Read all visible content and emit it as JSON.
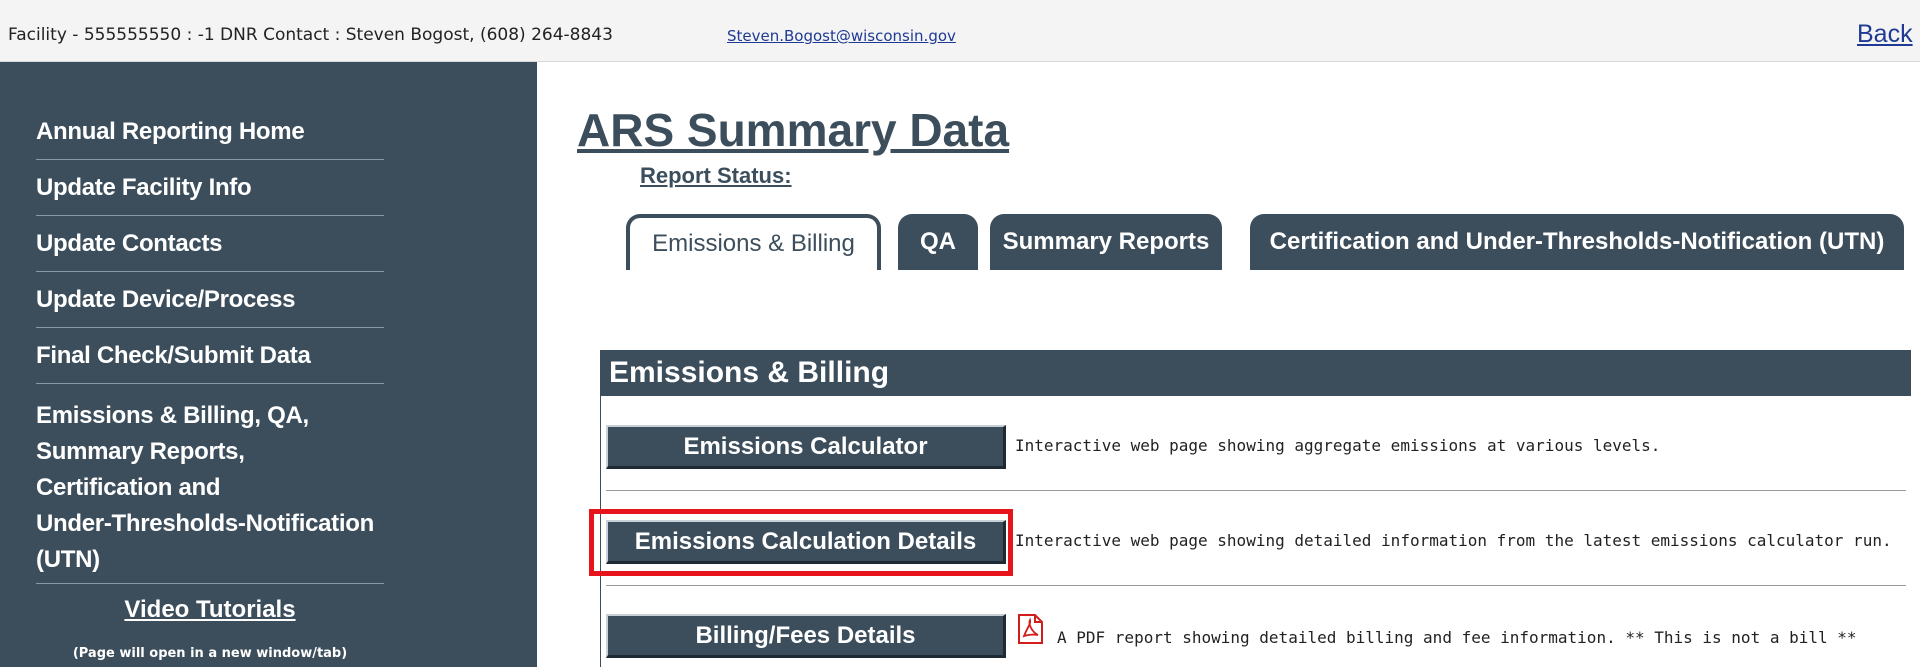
{
  "topbar": {
    "facility_text": "Facility - 555555550 : -1   DNR Contact : Steven Bogost, (608) 264-8843",
    "contact_email": "Steven.Bogost@wisconsin.gov",
    "back_label": "Back"
  },
  "sidebar": {
    "items": [
      {
        "label": "Annual Reporting Home"
      },
      {
        "label": "Update Facility Info"
      },
      {
        "label": "Update Contacts"
      },
      {
        "label": "Update Device/Process"
      },
      {
        "label": "Final Check/Submit Data"
      }
    ],
    "multi_item": {
      "lines": [
        "Emissions & Billing, QA,",
        "Summary Reports,",
        "Certification and",
        "Under-Thresholds-Notification",
        "(UTN)"
      ]
    },
    "video_title": "Video Tutorials",
    "video_note": "(Page will open in a new window/tab)"
  },
  "main": {
    "title": "ARS Summary Data",
    "report_status_label": "Report Status:",
    "tabs": [
      {
        "label": "Emissions & Billing",
        "active": true
      },
      {
        "label": "QA",
        "active": false
      },
      {
        "label": "Summary Reports",
        "active": false
      },
      {
        "label": "Certification and Under-Thresholds-Notification (UTN)",
        "active": false
      }
    ],
    "panel": {
      "header": "Emissions & Billing",
      "rows": [
        {
          "button": "Emissions Calculator",
          "description": "Interactive web page showing aggregate emissions at various levels."
        },
        {
          "button": "Emissions Calculation Details",
          "description": "Interactive web page showing detailed information from the latest emissions calculator run."
        },
        {
          "button": "Billing/Fees Details",
          "description": "A PDF report showing detailed billing and fee information. ** This is not a bill **",
          "icon": "pdf-icon"
        }
      ]
    }
  },
  "colors": {
    "primary": "#3c4e5c",
    "highlight": "#e8141c",
    "link": "#1f3a93"
  }
}
